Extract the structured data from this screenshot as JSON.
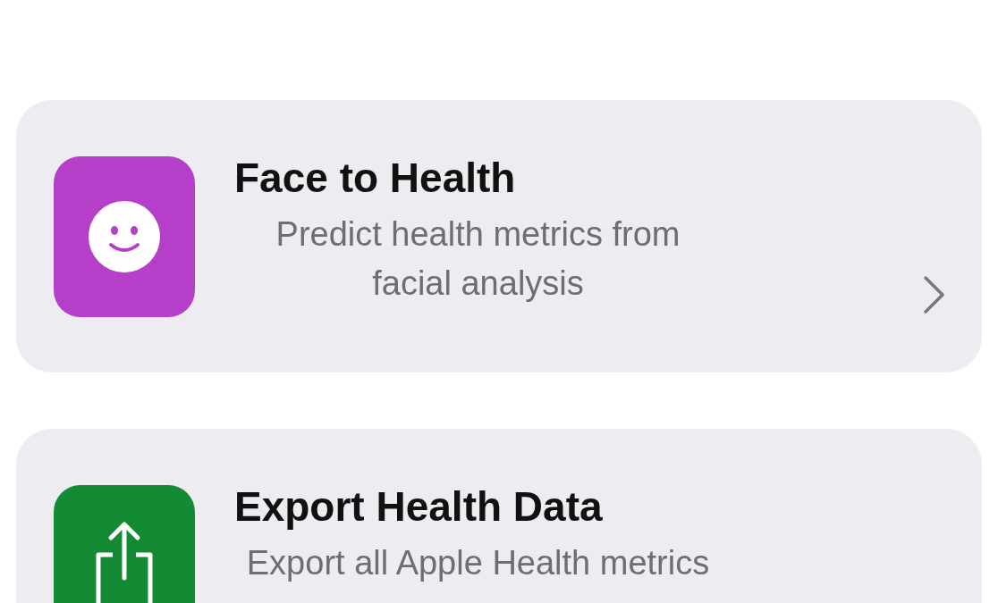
{
  "items": [
    {
      "title": "Face to Health",
      "subtitle": "Predict health metrics from facial analysis",
      "kind": "face",
      "color": "#b53fc9"
    },
    {
      "title": "Export Health Data",
      "subtitle": "Export all Apple Health metrics",
      "kind": "export",
      "color": "#148a35"
    }
  ]
}
